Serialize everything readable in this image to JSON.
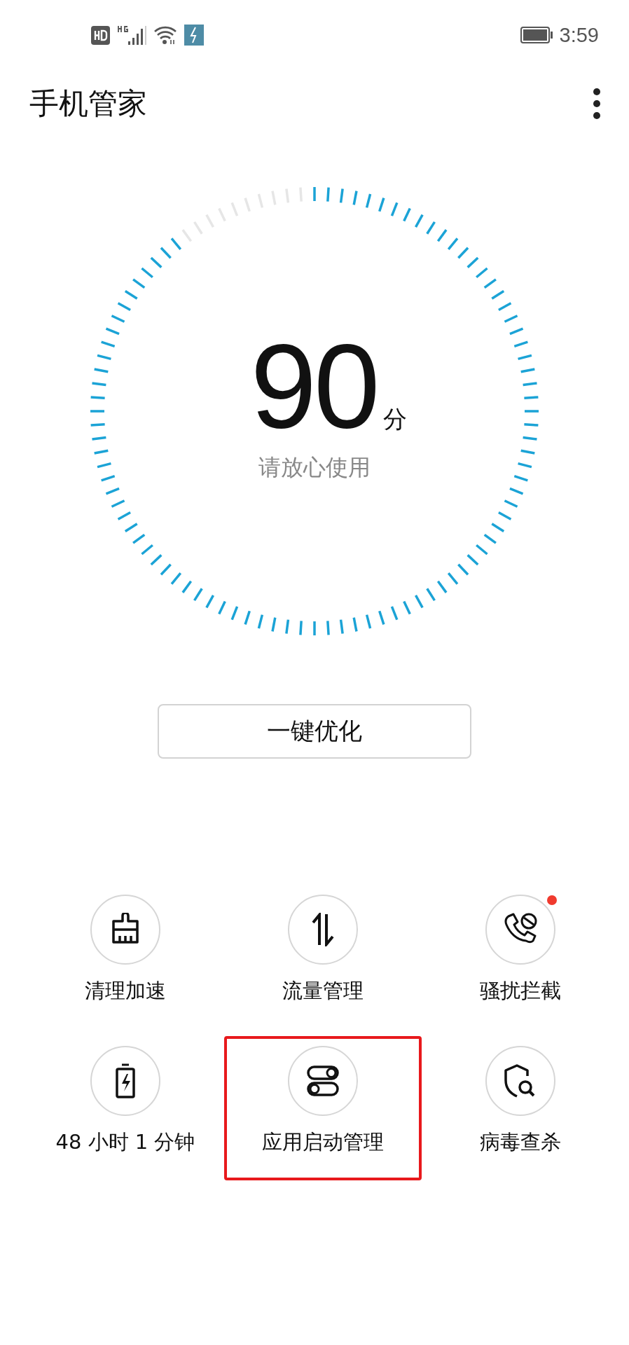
{
  "status_bar": {
    "time": "3:59"
  },
  "header": {
    "title": "手机管家"
  },
  "gauge": {
    "score": "90",
    "unit": "分",
    "caption": "请放心使用"
  },
  "optimize_button": {
    "label": "一键优化"
  },
  "tools": [
    {
      "kind": "broom",
      "label": "清理加速",
      "badge": false,
      "highlighted": false
    },
    {
      "kind": "data",
      "label": "流量管理",
      "badge": false,
      "highlighted": false
    },
    {
      "kind": "block",
      "label": "骚扰拦截",
      "badge": true,
      "highlighted": false
    },
    {
      "kind": "battery",
      "label": "48 小时 1 分钟",
      "badge": false,
      "highlighted": false
    },
    {
      "kind": "toggles",
      "label": "应用启动管理",
      "badge": false,
      "highlighted": true
    },
    {
      "kind": "virus",
      "label": "病毒查杀",
      "badge": false,
      "highlighted": false
    }
  ]
}
